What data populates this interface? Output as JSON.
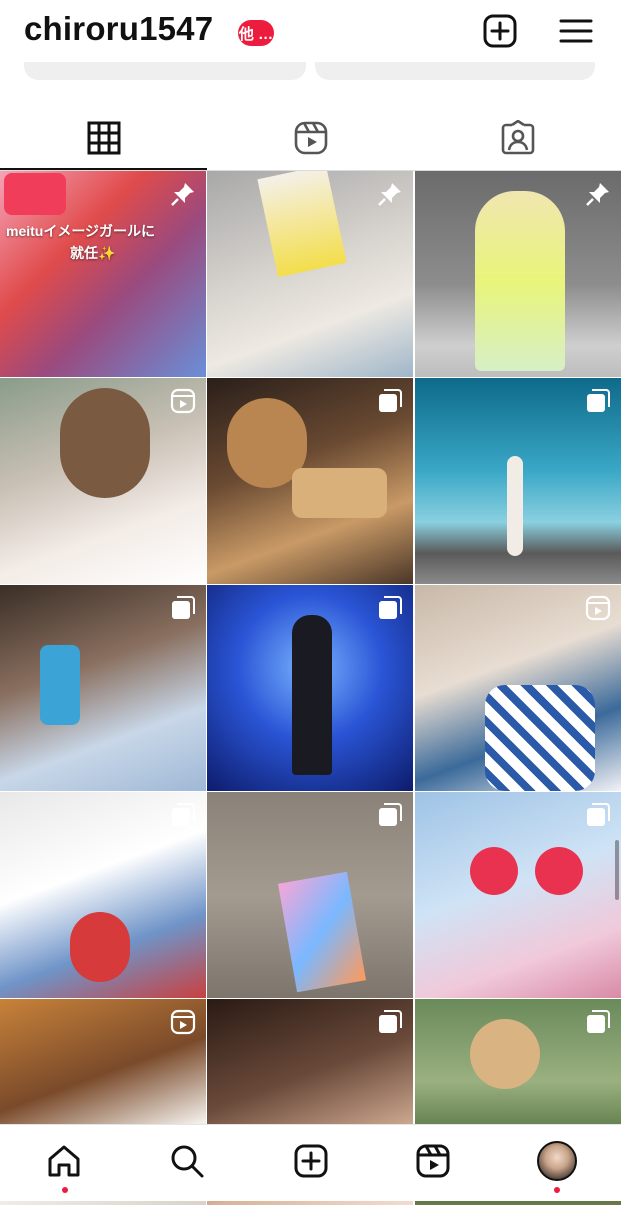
{
  "header": {
    "username": "chiroru1547",
    "notification_badge": "他 …",
    "create_icon": "plus-square-icon",
    "menu_icon": "hamburger-menu-icon"
  },
  "tabs": [
    {
      "name": "posts",
      "icon": "grid-icon",
      "active": true
    },
    {
      "name": "reels",
      "icon": "reels-icon",
      "active": false
    },
    {
      "name": "tagged",
      "icon": "tagged-person-icon",
      "active": false
    }
  ],
  "posts": [
    {
      "caption_line1": "meituイメージガールに",
      "caption_line2": "就任✨",
      "badge": "pin-icon"
    },
    {
      "badge": "pin-icon"
    },
    {
      "badge": "pin-icon"
    },
    {
      "badge": "reel-icon"
    },
    {
      "badge": "carousel-icon"
    },
    {
      "badge": "carousel-icon"
    },
    {
      "badge": "carousel-icon"
    },
    {
      "badge": "carousel-icon"
    },
    {
      "badge": "reel-icon"
    },
    {
      "badge": "carousel-icon"
    },
    {
      "badge": "carousel-icon"
    },
    {
      "badge": "carousel-icon"
    },
    {
      "badge": "reel-icon"
    },
    {
      "badge": "carousel-icon"
    },
    {
      "badge": "carousel-icon"
    }
  ],
  "bottom_nav": [
    "home-icon",
    "search-icon",
    "create-icon",
    "reels-icon",
    "profile-avatar"
  ],
  "colors": {
    "accent_red": "#ed1c3f",
    "divider": "#dbdbdb"
  }
}
